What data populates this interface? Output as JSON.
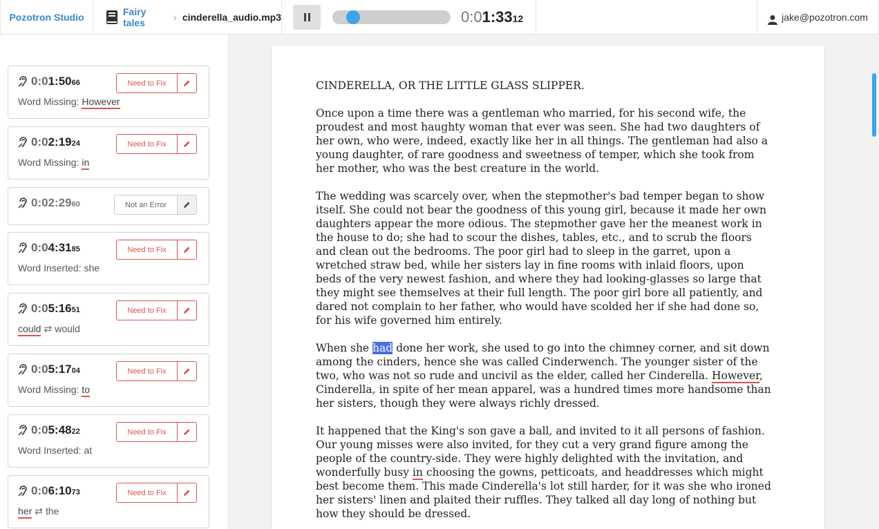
{
  "app": {
    "brand": "Pozotron Studio"
  },
  "breadcrumb": {
    "folder": "Fairy tales",
    "file": "cinderella_audio.mp3"
  },
  "player": {
    "state": "playing",
    "progress": 0.13,
    "time_dim": "0:0",
    "time_main": "1:33",
    "time_frames": "12"
  },
  "user": {
    "email": "jake@pozotron.com"
  },
  "colors": {
    "brand": "#3a87c9",
    "accent": "#3fa3e9",
    "error": "#d9534f",
    "highlight": "#4a6fe3"
  },
  "issues": [
    {
      "time_dim": "0:0",
      "time_main": "1:50",
      "frames": "66",
      "status": "Need to Fix",
      "type": "missing",
      "label": "Word Missing:",
      "word": "However"
    },
    {
      "time_dim": "0:0",
      "time_main": "2:19",
      "frames": "24",
      "status": "Need to Fix",
      "type": "missing",
      "label": "Word Missing:",
      "word": "in"
    },
    {
      "time_dim": "0:02:29",
      "time_main": "",
      "frames": "60",
      "status": "Not an Error",
      "type": "none"
    },
    {
      "time_dim": "0:0",
      "time_main": "4:31",
      "frames": "85",
      "status": "Need to Fix",
      "type": "inserted",
      "label": "Word Inserted: she"
    },
    {
      "time_dim": "0:0",
      "time_main": "5:16",
      "frames": "51",
      "status": "Need to Fix",
      "type": "replace",
      "from": "could",
      "to": "would"
    },
    {
      "time_dim": "0:0",
      "time_main": "5:17",
      "frames": "04",
      "status": "Need to Fix",
      "type": "missing",
      "label": "Word Missing:",
      "word": "to"
    },
    {
      "time_dim": "0:0",
      "time_main": "5:48",
      "frames": "22",
      "status": "Need to Fix",
      "type": "inserted",
      "label": "Word Inserted: at"
    },
    {
      "time_dim": "0:0",
      "time_main": "6:10",
      "frames": "73",
      "status": "Need to Fix",
      "type": "replace",
      "from": "her",
      "to": "the"
    }
  ],
  "document": {
    "title": "CINDERELLA, OR THE LITTLE GLASS SLIPPER.",
    "p1": [
      "Once upon a time there was a gentleman who married, for his second wife, the",
      "proudest and most haughty woman that ever was seen. She had two daughters of",
      "her own, who were, indeed, exactly like her in all things. The gentleman had also a",
      "young daughter, of rare goodness and sweetness of temper, which she took from",
      "her mother, who was the best creature in the world."
    ],
    "p2": [
      "The wedding was scarcely over, when the stepmother's bad temper began to show",
      "itself. She could not bear the goodness of this young girl, because it made her own",
      "daughters appear the more odious. The stepmother gave her the meanest work in",
      "the house to do; she had to scour the dishes, tables, etc., and to scrub the floors",
      "and clean out the bedrooms. The poor girl had to sleep in the garret, upon a",
      "wretched straw bed, while her sisters lay in fine rooms with inlaid floors, upon",
      "beds of the very newest fashion, and where they had looking-glasses so large that",
      "they might see themselves at their full length. The poor girl bore all patiently, and",
      "dared not complain to her father, who would have scolded her if she had done so,",
      "for his wife governed him entirely."
    ],
    "p3_l1_a": "When she ",
    "p3_l1_hl": "had",
    "p3_l1_b": " done her work, she used to go into the chimney corner, and sit down",
    "p3_l2": "among the cinders, hence she was called Cinderwench. The younger sister of the",
    "p3_l3_a": "two, who was not so rude and uncivil as the elder, called her Cinderella. ",
    "p3_l3_err": "However",
    "p3_l3_b": ",",
    "p3_l4": "Cinderella, in spite of her mean apparel, was a hundred times more handsome than",
    "p3_l5": "her sisters, though they were always richly dressed.",
    "p4_l1": "It happened that the King's son gave a ball, and invited to it all persons of fashion.",
    "p4_l2": "Our young misses were also invited, for they cut a very grand figure among the",
    "p4_l3": "people of the country-side. They were highly delighted with the invitation, and",
    "p4_l4_a": "wonderfully busy ",
    "p4_l4_err": "in",
    "p4_l4_b": " choosing the gowns, petticoats, and headdresses which might",
    "p4_l5": "best become them. This made Cinderella's lot still harder, for it was she who ironed",
    "p4_l6": "her sisters' linen and plaited their ruffles. They talked all day long of nothing but",
    "p4_l7": "how they should be dressed."
  }
}
